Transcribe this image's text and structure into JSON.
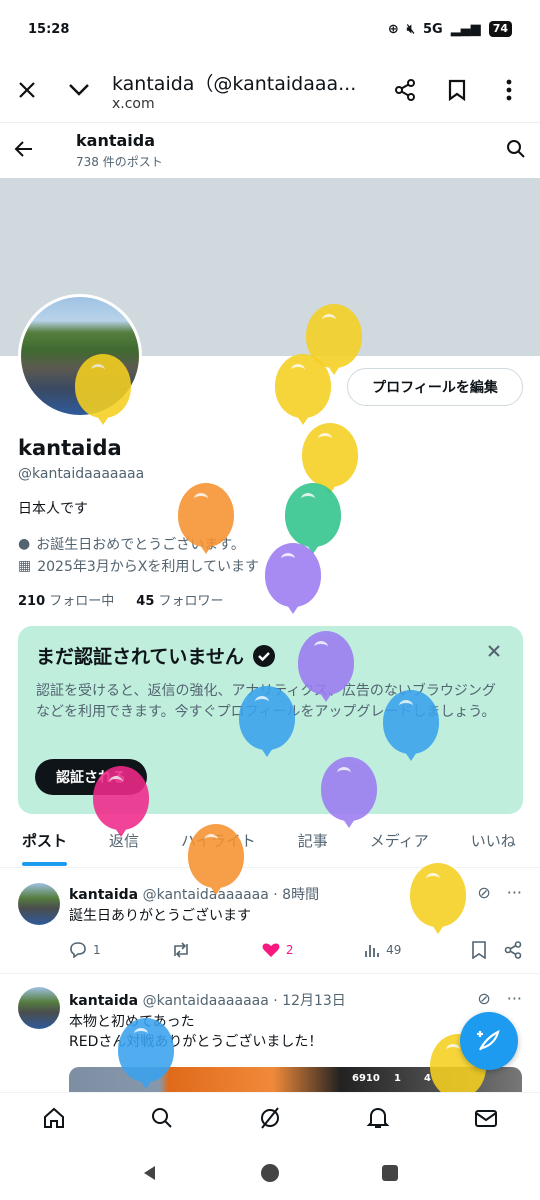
{
  "status": {
    "time": "15:28",
    "network": "5G",
    "battery": "74"
  },
  "browser": {
    "title": "kantaida（@kantaidaaa...",
    "url": "x.com"
  },
  "header": {
    "name": "kantaida",
    "posts": "738 件のポスト"
  },
  "profile": {
    "edit_label": "プロフィールを編集",
    "display_name": "kantaida",
    "handle": "@kantaidaaaaaaa",
    "bio": "日本人です",
    "birthday": "お誕生日おめでとうございます。",
    "joined": "2025年3月からXを利用しています",
    "following_count": "210",
    "following_label": "フォロー中",
    "followers_count": "45",
    "followers_label": "フォロワー"
  },
  "verify": {
    "title": "まだ認証されていません",
    "desc": "認証を受けると、返信の強化、アナリティクス、広告のないブラウジングなどを利用できます。今すぐプロフィールをアップグレードしましょう。",
    "button": "認証される"
  },
  "tabs": [
    "ポスト",
    "返信",
    "ハイライト",
    "記事",
    "メディア",
    "いいね"
  ],
  "tweets": [
    {
      "name": "kantaida",
      "handle": "@kantaidaaaaaaa",
      "time": "8時間",
      "text": "誕生日ありがとうございます",
      "replies": "1",
      "likes": "2",
      "views": "49"
    },
    {
      "name": "kantaida",
      "handle": "@kantaidaaaaaaa",
      "time": "12月13日",
      "text_line1": "本物と初めてあった",
      "text_line2": "REDさん対戦ありがとうございました！",
      "media_text1": "6910",
      "media_text2": "1",
      "media_text3": "4"
    }
  ],
  "colors": {
    "accent": "#1d9bf0",
    "like": "#f91880",
    "verify_bg": "#bfeedd",
    "banner": "#cfd9de"
  }
}
